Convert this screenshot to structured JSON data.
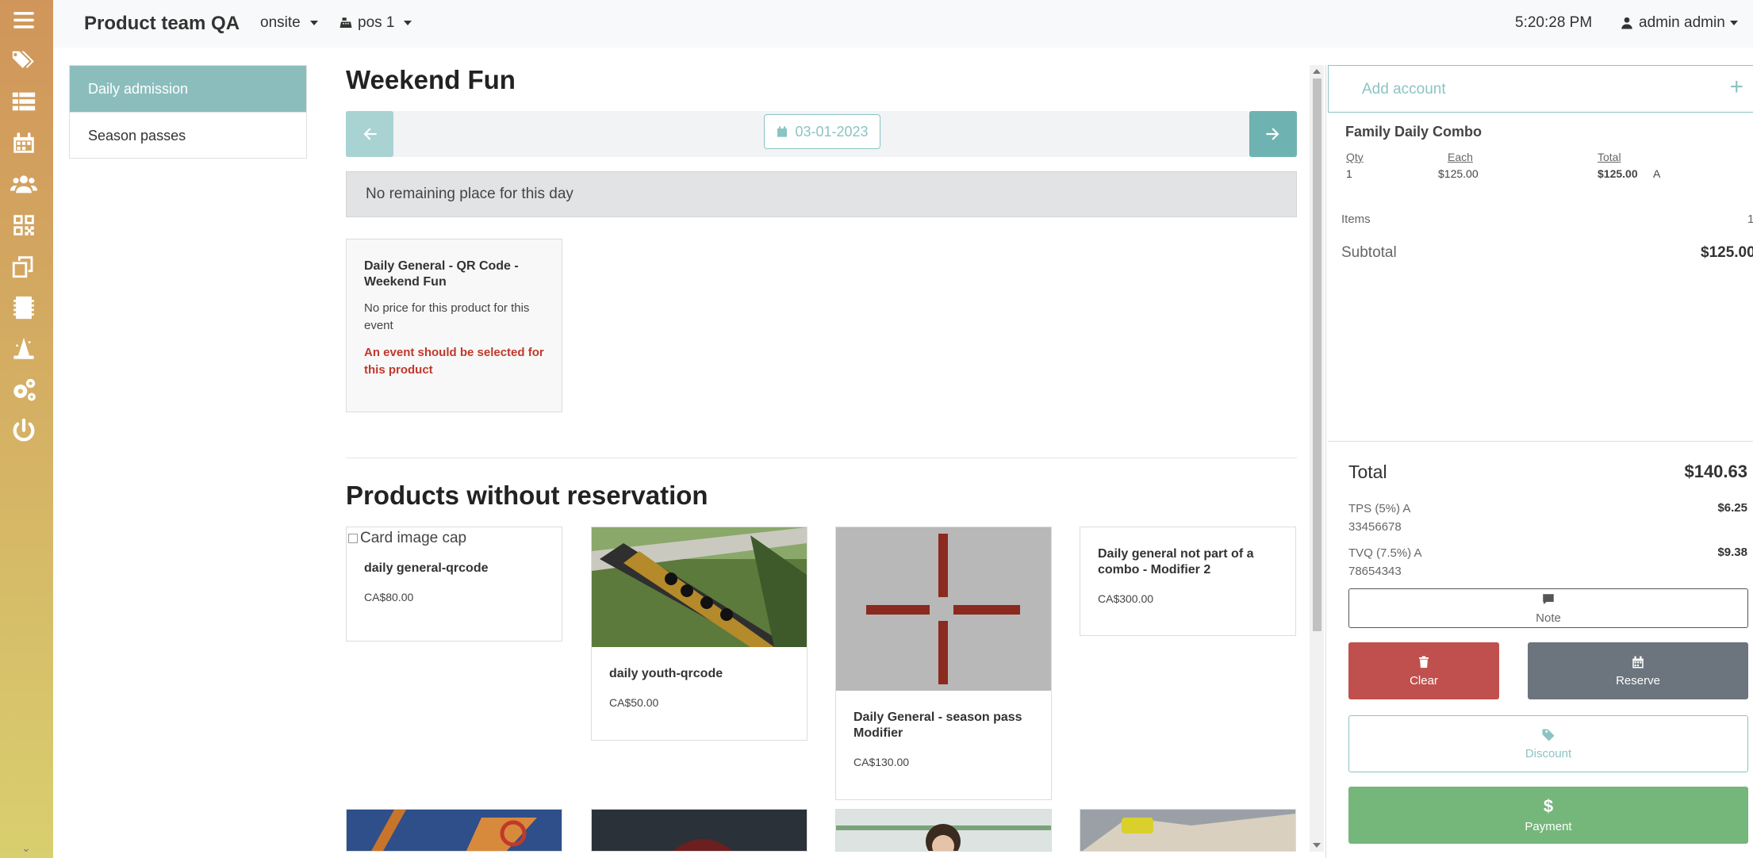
{
  "topnav": {
    "brand": "Product team QA",
    "location": "onsite",
    "pos": "pos 1",
    "clock": "5:20:28 PM",
    "user": "admin admin"
  },
  "icon_bar": [
    "menu-icon",
    "tags-icon",
    "list-icon",
    "calendar-icon",
    "users-icon",
    "qrcode-icon",
    "copy-icon",
    "sd-card-icon",
    "wizard-icon",
    "gears-icon",
    "power-icon"
  ],
  "submenu": {
    "items": [
      {
        "label": "Daily admission",
        "active": true
      },
      {
        "label": "Season passes",
        "active": false
      }
    ]
  },
  "main": {
    "title": "Weekend Fun",
    "date": "03-01-2023",
    "alert": "No remaining place for this day",
    "event_card": {
      "title": "Daily General - QR Code - Weekend Fun",
      "text": "No price for this product for this event",
      "error": "An event should be selected for this product"
    },
    "products_heading": "Products without reservation",
    "products": [
      {
        "title": "daily general-qrcode",
        "price": "CA$80.00",
        "image_alt": "Card image cap"
      },
      {
        "title": "daily youth-qrcode",
        "price": "CA$50.00"
      },
      {
        "title": "Daily General - season pass Modifier",
        "price": "CA$130.00"
      },
      {
        "title": "Daily general not part of a combo - Modifier 2",
        "price": "CA$300.00"
      }
    ]
  },
  "cart": {
    "add_account_placeholder": "Add account",
    "line": {
      "title": "Family Daily Combo",
      "qty_label": "Qty",
      "each_label": "Each",
      "total_label": "Total",
      "qty": "1",
      "each": "$125.00",
      "total": "$125.00",
      "tax_code": "A"
    },
    "items_label": "Items",
    "items_value": "1",
    "subtotal_label": "Subtotal",
    "subtotal_value": "$125.00",
    "total_label": "Total",
    "total_value": "$140.63",
    "taxes": [
      {
        "label": "TPS (5%) A",
        "number": "33456678",
        "value": "$6.25"
      },
      {
        "label": "TVQ (7.5%) A",
        "number": "78654343",
        "value": "$9.38"
      }
    ],
    "buttons": {
      "note": "Note",
      "clear": "Clear",
      "reserve": "Reserve",
      "discount": "Discount",
      "payment": "Payment",
      "payment_symbol": "$"
    }
  },
  "colors": {
    "teal": "#8cbdbd",
    "danger": "#c0504d",
    "secondary": "#6c757d",
    "success": "#75b77a",
    "error_text": "#c0392b"
  }
}
